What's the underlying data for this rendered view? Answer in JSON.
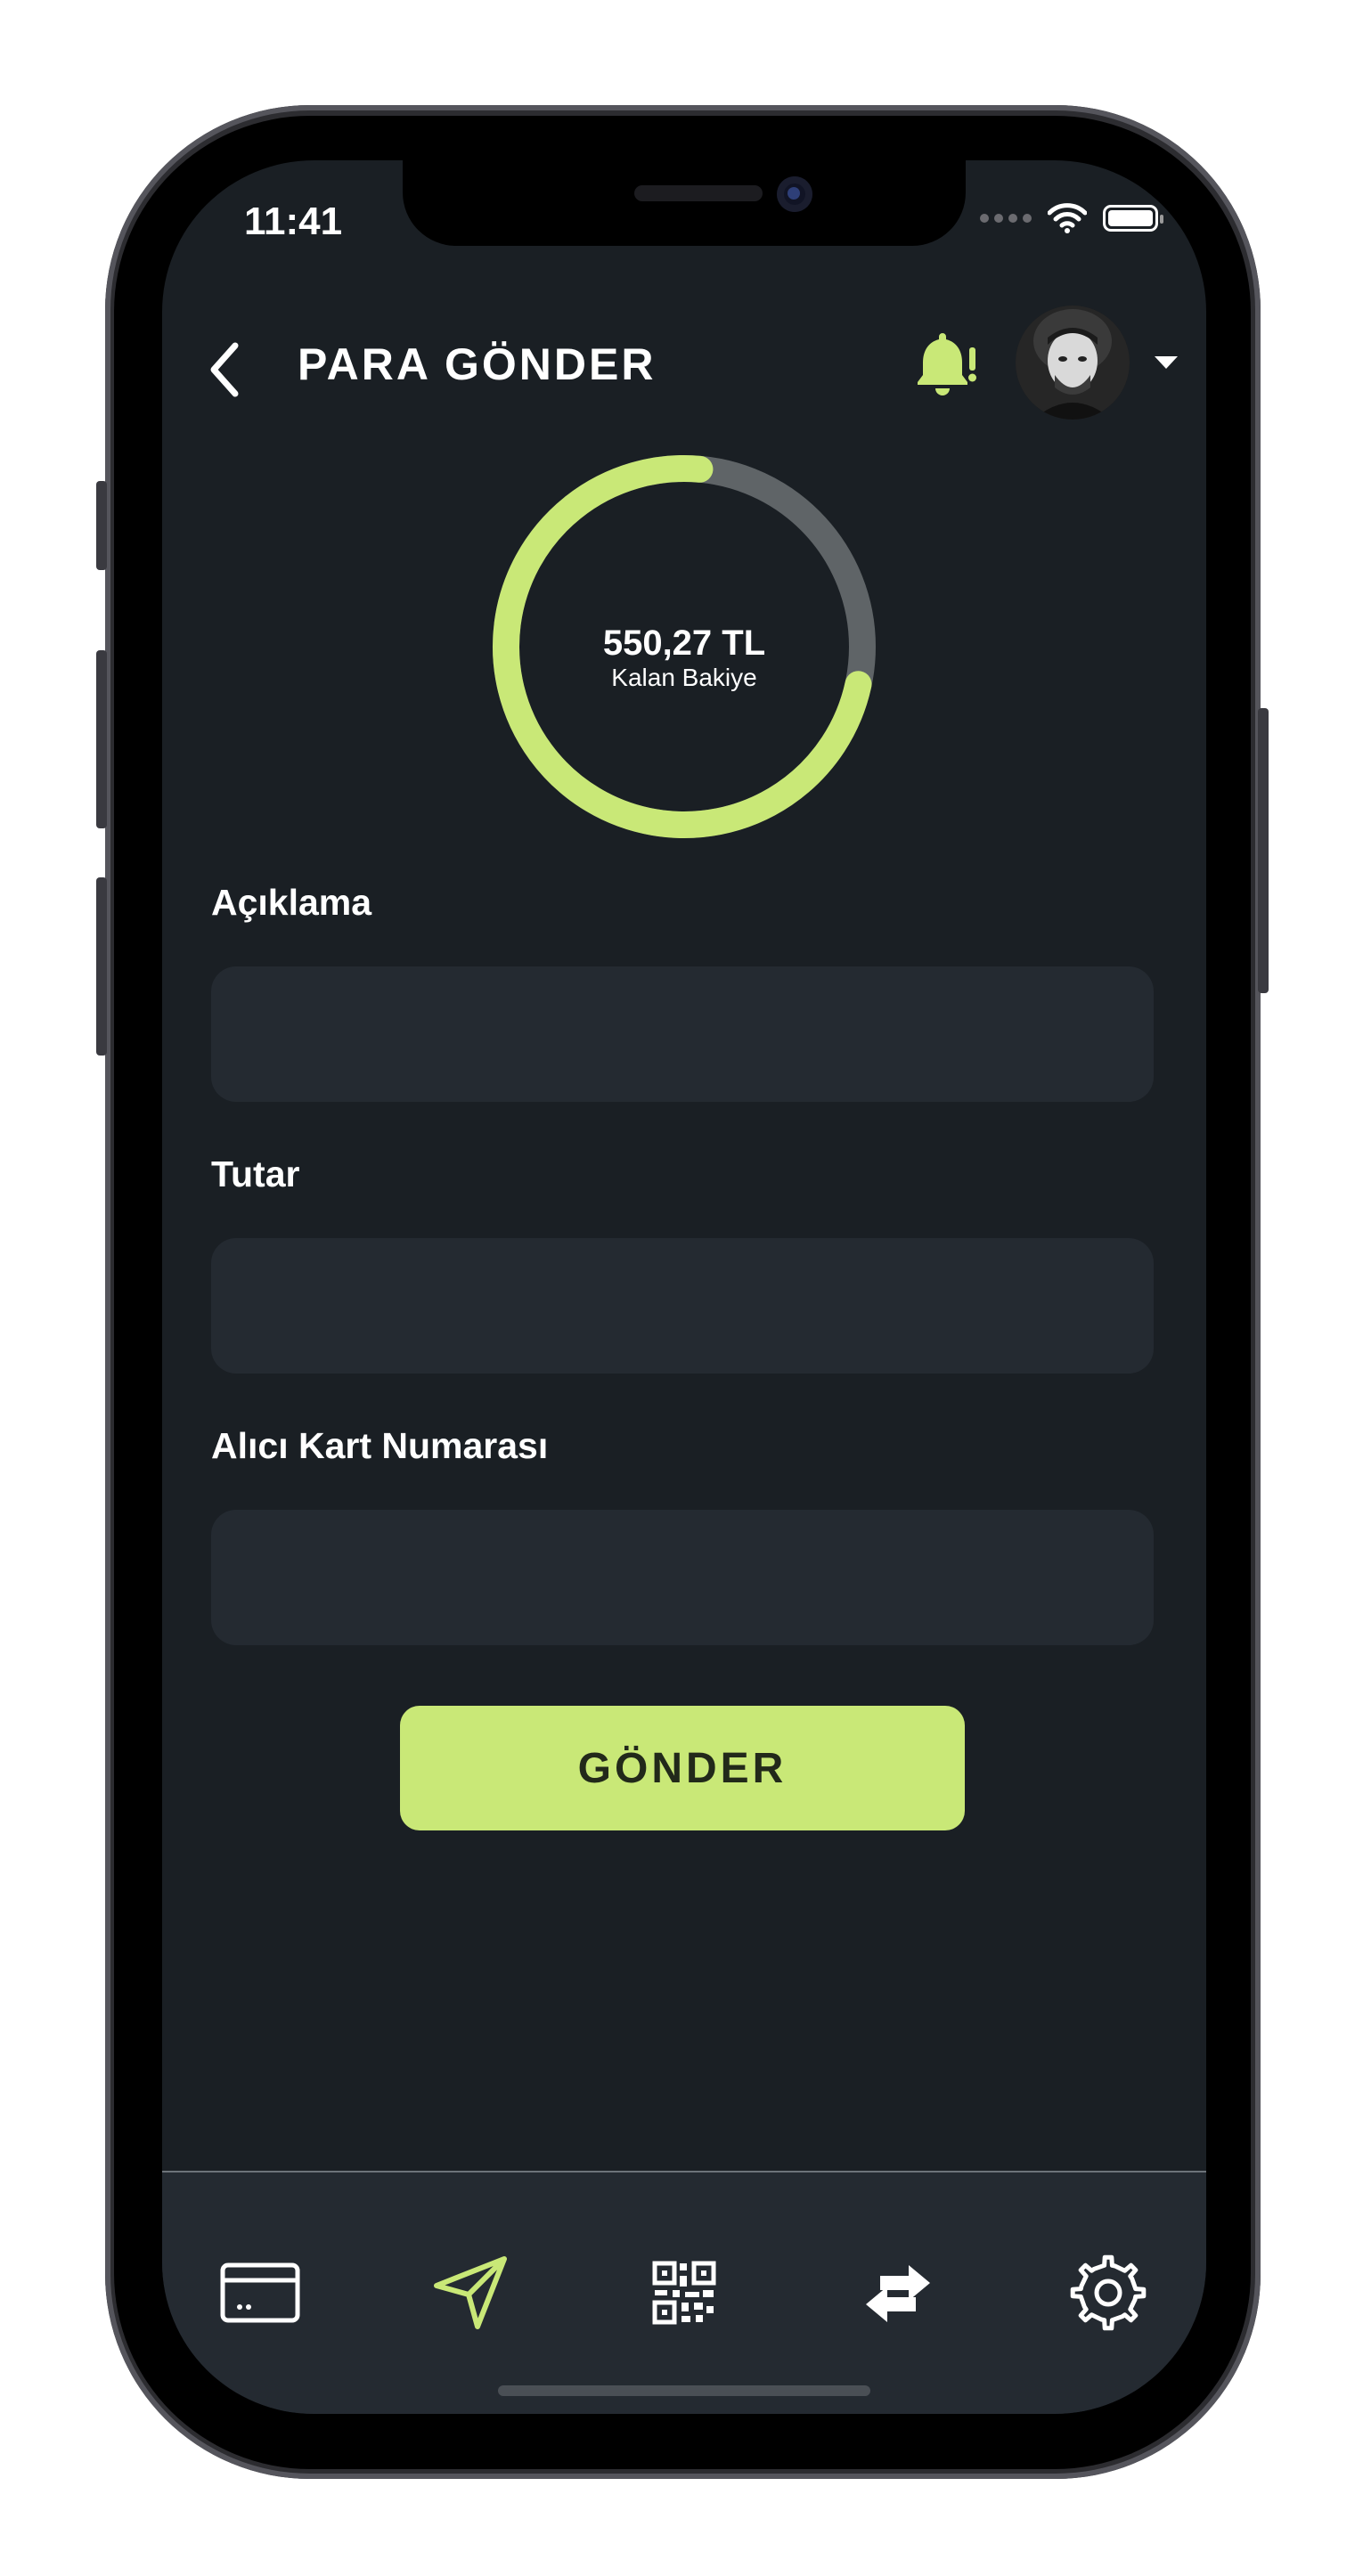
{
  "status_bar": {
    "time": "11:41"
  },
  "header": {
    "title": "PARA GÖNDER"
  },
  "balance": {
    "amount": "550,27 TL",
    "label": "Kalan Bakiye",
    "used_fraction": 0.27
  },
  "form": {
    "description_label": "Açıklama",
    "amount_label": "Tutar",
    "card_label": "Alıcı Kart Numarası",
    "description_value": "",
    "amount_value": "",
    "card_value": ""
  },
  "send_button": "GÖNDER",
  "tabs": [
    {
      "name": "cards",
      "icon": "credit-card-icon",
      "active": false
    },
    {
      "name": "send",
      "icon": "paper-plane-icon",
      "active": true
    },
    {
      "name": "qr",
      "icon": "qr-code-icon",
      "active": false
    },
    {
      "name": "transfer",
      "icon": "swap-arrows-icon",
      "active": false
    },
    {
      "name": "settings",
      "icon": "gear-icon",
      "active": false
    }
  ],
  "colors": {
    "accent": "#c9e877",
    "background": "#1a1f24",
    "field": "#242a31",
    "ring_track": "#5f6467"
  }
}
